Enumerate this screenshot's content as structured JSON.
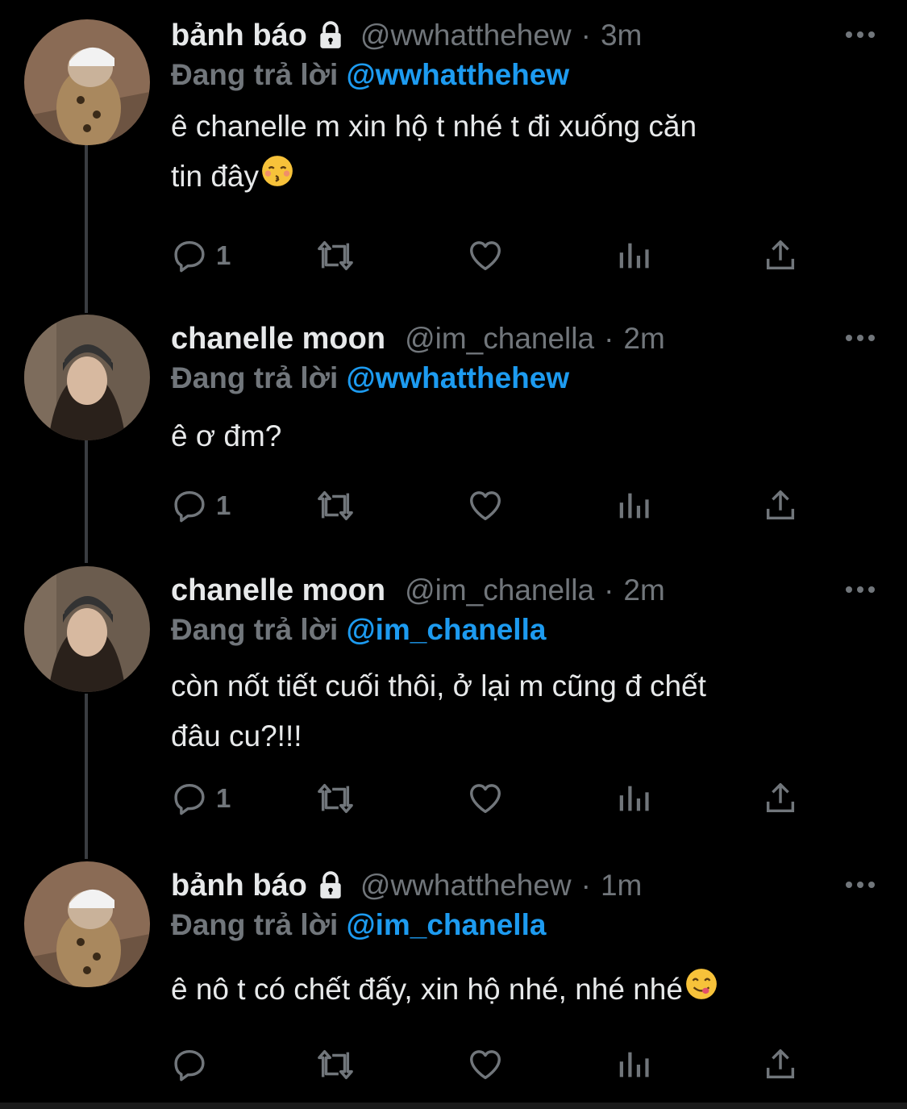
{
  "colors": {
    "background": "#000000",
    "text": "#e7e9ea",
    "muted": "#71767b",
    "accent": "#1d9bf0",
    "thread_line": "#3a3d41"
  },
  "tweets": [
    {
      "name": "bảnh báo",
      "protected": true,
      "handle": "@wwhatthehew",
      "dot": "·",
      "time": "3m",
      "replying_prefix": "Đang trả lời",
      "replying_to": "@wwhatthehew",
      "text_lines": [
        "ê chanelle m xin hộ t nhé t đi xuống căn",
        "tin đây"
      ],
      "emoji": "kissing-face-closed-eyes",
      "reply_count": "1"
    },
    {
      "name": "chanelle moon",
      "protected": false,
      "handle": "@im_chanella",
      "dot": "·",
      "time": "2m",
      "replying_prefix": "Đang trả lời",
      "replying_to": "@wwhatthehew",
      "text_lines": [
        "ê ơ đm?"
      ],
      "reply_count": "1"
    },
    {
      "name": "chanelle moon",
      "protected": false,
      "handle": "@im_chanella",
      "dot": "·",
      "time": "2m",
      "replying_prefix": "Đang trả lời",
      "replying_to": "@im_chanella",
      "text_lines": [
        "còn nốt tiết cuối thôi, ở lại m cũng đ chết",
        "đâu cu?!!!"
      ],
      "reply_count": "1"
    },
    {
      "name": "bảnh báo",
      "protected": true,
      "handle": "@wwhatthehew",
      "dot": "·",
      "time": "1m",
      "replying_prefix": "Đang trả lời",
      "replying_to": "@im_chanella",
      "text_lines": [
        "ê nô t có chết đấy, xin hộ nhé, nhé nhé"
      ],
      "emoji": "face-savoring-food",
      "reply_count": ""
    }
  ]
}
